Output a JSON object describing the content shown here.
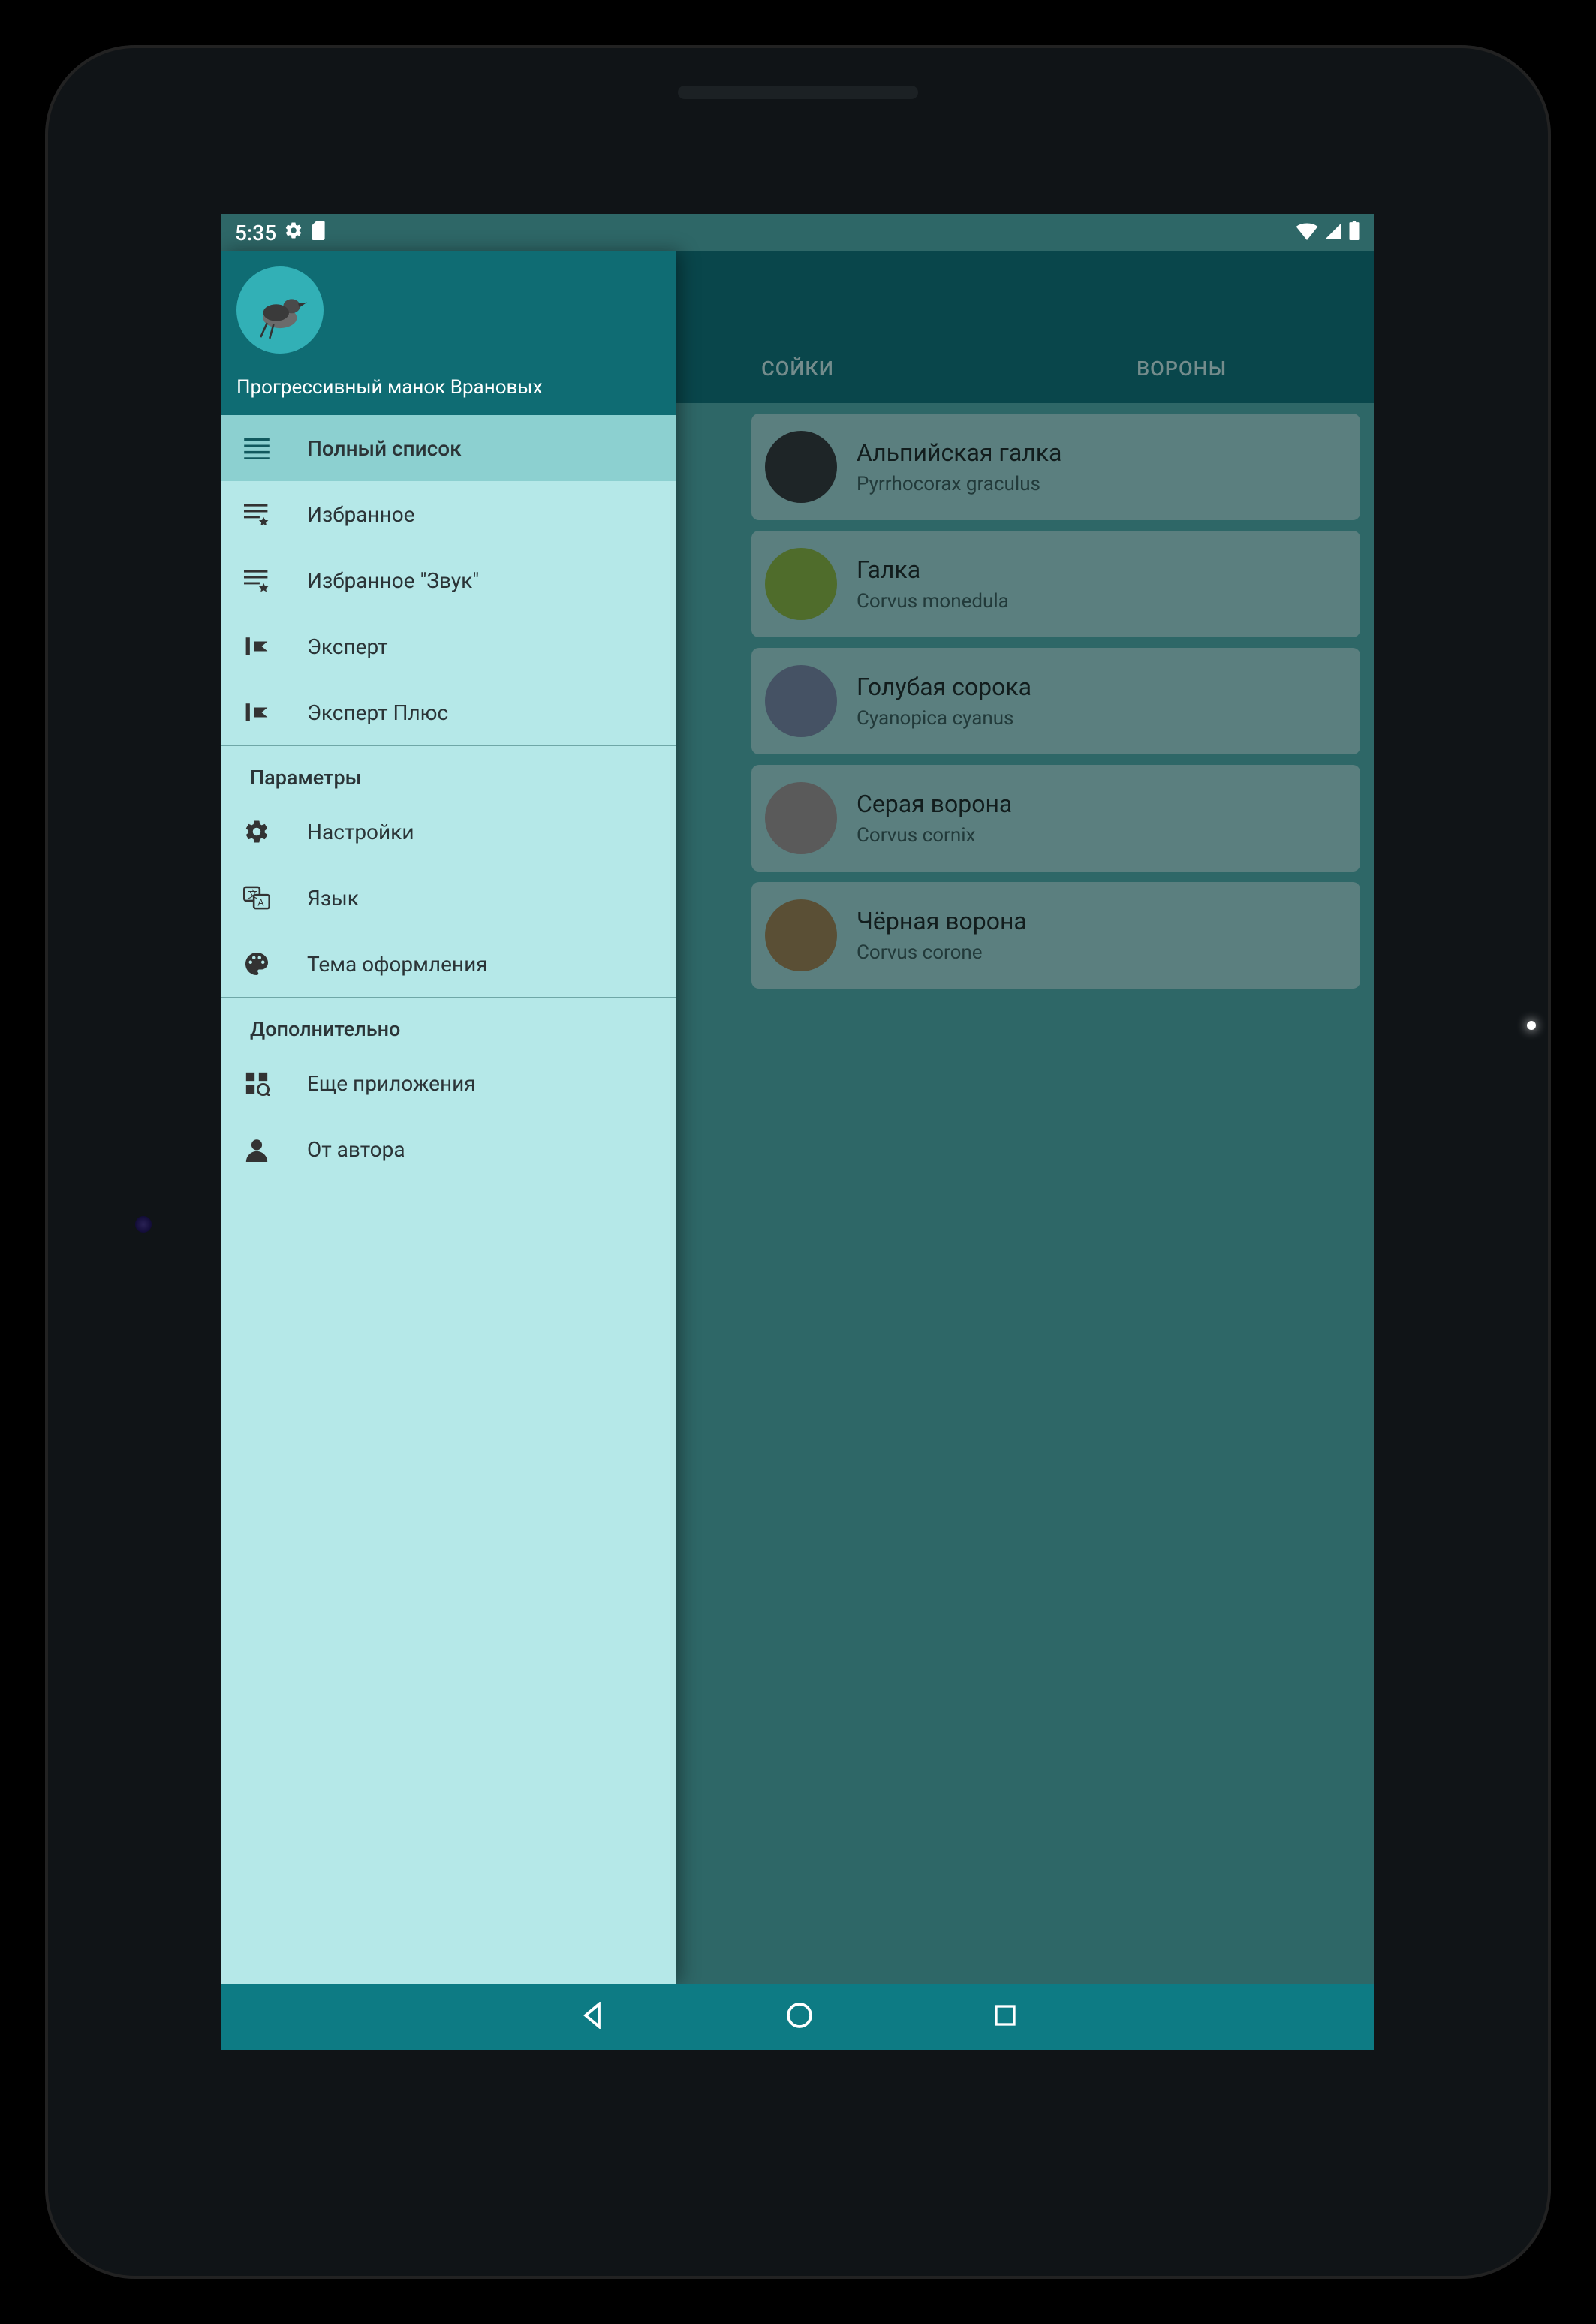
{
  "statusbar": {
    "time": "5:35"
  },
  "drawer": {
    "title": "Прогрессивный манок Врановых",
    "items": [
      {
        "icon": "list",
        "label": "Полный список",
        "active": true
      },
      {
        "icon": "list-star",
        "label": "Избранное"
      },
      {
        "icon": "list-star",
        "label": "Избранное \"Звук\""
      },
      {
        "icon": "expert",
        "label": "Эксперт"
      },
      {
        "icon": "expert",
        "label": "Эксперт Плюс"
      }
    ],
    "section_params": "Параметры",
    "params_items": [
      {
        "icon": "gear",
        "label": "Настройки"
      },
      {
        "icon": "lang",
        "label": "Язык"
      },
      {
        "icon": "palette",
        "label": "Тема оформления"
      }
    ],
    "section_more": "Дополнительно",
    "more_items": [
      {
        "icon": "apps",
        "label": "Еще приложения"
      },
      {
        "icon": "user",
        "label": "От автора"
      }
    ]
  },
  "tabs": {
    "tab1": "СОЙКИ",
    "tab2": "ВОРОНЫ"
  },
  "birds": [
    {
      "name": "Альпийская галка",
      "latin": "Pyrrhocorax graculus",
      "avatar": "#2f3a3d"
    },
    {
      "name": "Галка",
      "latin": "Corvus monedula",
      "avatar": "#7aa642"
    },
    {
      "name": "Голубая сорока",
      "latin": "Cyanopica cyanus",
      "avatar": "#6a7f9a"
    },
    {
      "name": "Серая ворона",
      "latin": "Corvus cornix",
      "avatar": "#8a8a8a"
    },
    {
      "name": "Чёрная ворона",
      "latin": "Corvus corone",
      "avatar": "#8a7a52"
    }
  ]
}
